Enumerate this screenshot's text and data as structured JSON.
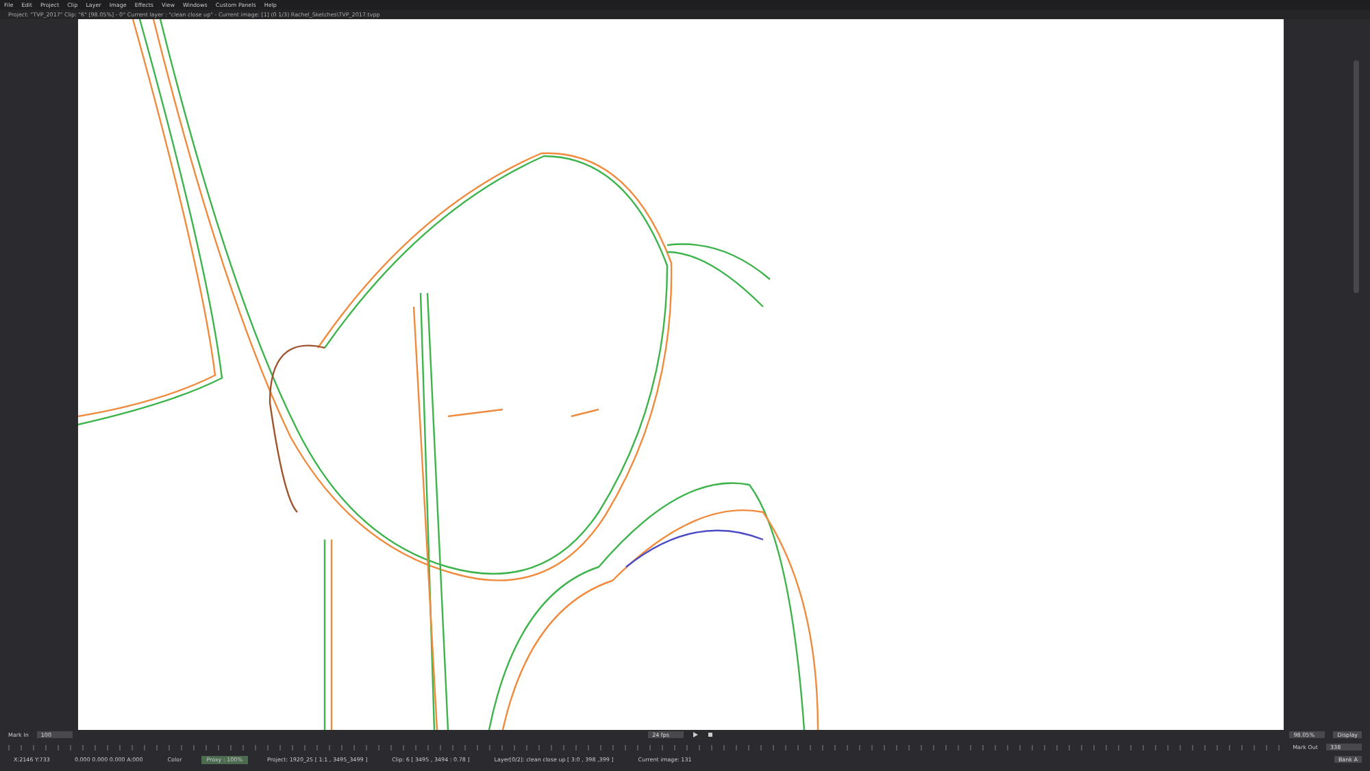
{
  "menu": [
    "File",
    "Edit",
    "Project",
    "Clip",
    "Layer",
    "Image",
    "Effects",
    "View",
    "Windows",
    "Custom Panels",
    "Help"
  ],
  "title": "Project: \"TVP_2017\" Clip: \"6\" [98.05%] - 0° Current layer : \"clean close up\" - Current image: [1] (0 1/3) Rachel_Sketches\\TVP_2017.tvpp",
  "timeline": {
    "mark_in": "Mark In",
    "mark_in_value": "100",
    "fps": "24 fps",
    "zoom": "98.05%",
    "display": "Display",
    "mark_out": "Mark Out",
    "mark_out_value": "338"
  },
  "status_bar": [
    "X:2146 Y:733",
    "0.000 0.000 0.000 A:000",
    "Color",
    "Proxy : 100%",
    "Project: 1920_25 [ 1:1 , 3495_3499 ]",
    "Clip: 6 [ 3495 , 3494 : 0.78 ]",
    "Layer[0/2]: clean close up [ 3:0 , 398 ,399 ]",
    "Current image: 131"
  ],
  "bank": "Bank A"
}
